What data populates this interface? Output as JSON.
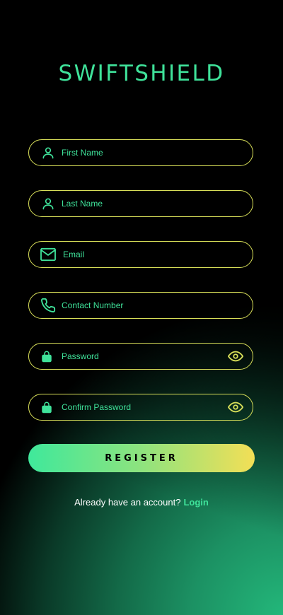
{
  "brand": {
    "title": "SWIFTSHIELD"
  },
  "form": {
    "fields": [
      {
        "id": "first-name",
        "placeholder": "First Name",
        "icon": "user-icon",
        "value": ""
      },
      {
        "id": "last-name",
        "placeholder": "Last Name",
        "icon": "user-icon",
        "value": ""
      },
      {
        "id": "email",
        "placeholder": "Email",
        "icon": "mail-icon",
        "value": ""
      },
      {
        "id": "contact-number",
        "placeholder": "Contact Number",
        "icon": "phone-icon",
        "value": ""
      },
      {
        "id": "password",
        "placeholder": "Password",
        "icon": "lock-icon",
        "value": "",
        "toggle_icon": "eye-icon"
      },
      {
        "id": "confirm-password",
        "placeholder": "Confirm Password",
        "icon": "lock-icon",
        "value": "",
        "toggle_icon": "eye-icon"
      }
    ],
    "register_label": "REGISTER"
  },
  "footer": {
    "prompt": "Already have an account?",
    "login_label": "Login"
  },
  "colors": {
    "accent_green": "#3fe29a",
    "accent_yellow": "#d8df59",
    "background": "#000000"
  }
}
